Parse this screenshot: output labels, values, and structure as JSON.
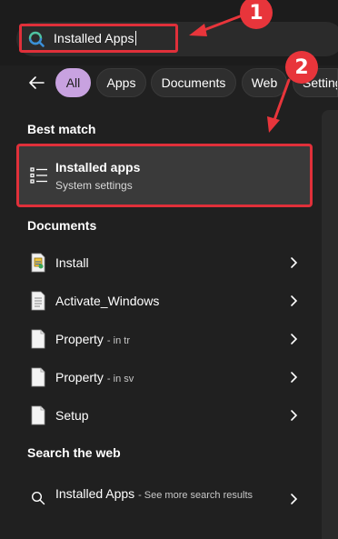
{
  "search": {
    "value": "Installed Apps"
  },
  "filters": [
    "All",
    "Apps",
    "Documents",
    "Web",
    "Setting"
  ],
  "best_match": {
    "heading": "Best match",
    "title": "Installed apps",
    "subtitle": "System settings"
  },
  "documents": {
    "heading": "Documents",
    "items": [
      {
        "label": "Install",
        "suffix": ""
      },
      {
        "label": "Activate_Windows",
        "suffix": ""
      },
      {
        "label": "Property",
        "suffix": "- in tr"
      },
      {
        "label": "Property",
        "suffix": "- in sv"
      },
      {
        "label": "Setup",
        "suffix": ""
      }
    ]
  },
  "web": {
    "heading": "Search the web",
    "label": "Installed Apps",
    "suffix": "- See more search results"
  },
  "annotations": {
    "badge_1": "1",
    "badge_2": "2",
    "color": "#e8353b"
  },
  "colors": {
    "accent": "#c8a2e0",
    "background": "#202020"
  }
}
